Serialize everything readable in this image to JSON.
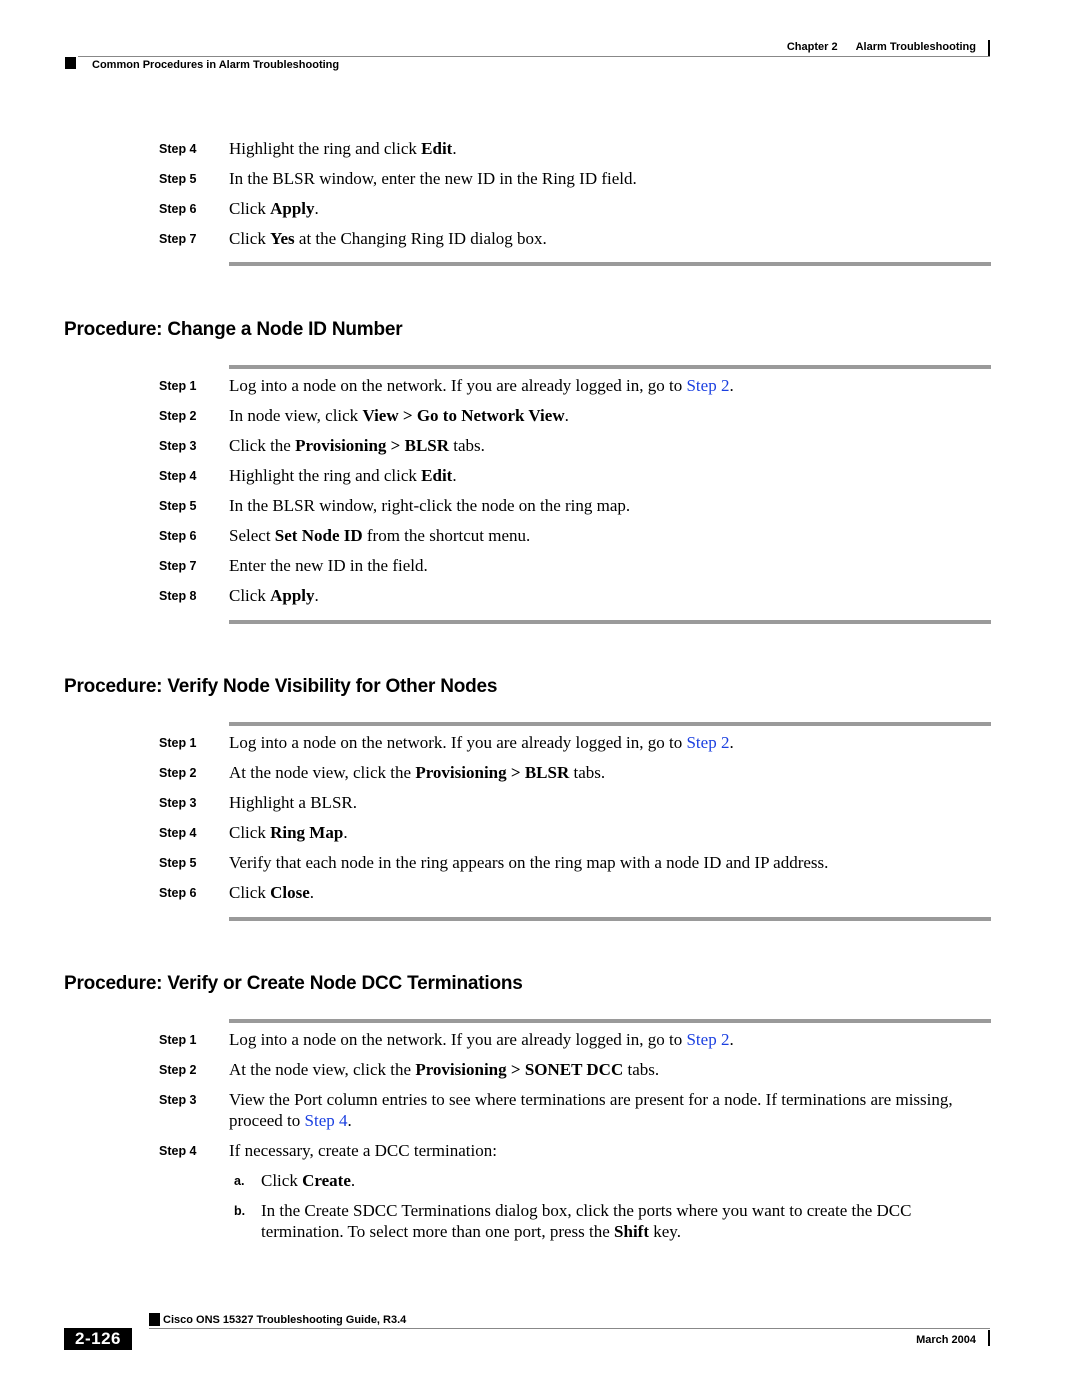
{
  "header": {
    "chapter": "Chapter 2",
    "chapter_title": "Alarm Troubleshooting",
    "section": "Common Procedures in Alarm Troubleshooting"
  },
  "continued_steps": [
    {
      "label": "Step 4",
      "parts": [
        {
          "t": "Highlight the ring and click "
        },
        {
          "b": "Edit"
        },
        {
          "t": "."
        }
      ]
    },
    {
      "label": "Step 5",
      "parts": [
        {
          "t": "In the BLSR window, enter the new ID in the Ring ID field."
        }
      ]
    },
    {
      "label": "Step 6",
      "parts": [
        {
          "t": "Click "
        },
        {
          "b": "Apply"
        },
        {
          "t": "."
        }
      ]
    },
    {
      "label": "Step 7",
      "parts": [
        {
          "t": "Click "
        },
        {
          "b": "Yes"
        },
        {
          "t": " at the Changing Ring ID dialog box."
        }
      ]
    }
  ],
  "procedures": [
    {
      "title": "Procedure: Change a Node ID Number",
      "steps": [
        {
          "label": "Step 1",
          "parts": [
            {
              "t": "Log into a node on the network. If you are already logged in, go to "
            },
            {
              "a": "Step 2"
            },
            {
              "t": "."
            }
          ]
        },
        {
          "label": "Step 2",
          "parts": [
            {
              "t": "In node view, click "
            },
            {
              "b": "View > Go to Network View"
            },
            {
              "t": "."
            }
          ]
        },
        {
          "label": "Step 3",
          "parts": [
            {
              "t": "Click the "
            },
            {
              "b": "Provisioning > BLSR"
            },
            {
              "t": " tabs."
            }
          ]
        },
        {
          "label": "Step 4",
          "parts": [
            {
              "t": "Highlight the ring and click "
            },
            {
              "b": "Edit"
            },
            {
              "t": "."
            }
          ]
        },
        {
          "label": "Step 5",
          "parts": [
            {
              "t": "In the BLSR window, right-click the node on the ring map."
            }
          ]
        },
        {
          "label": "Step 6",
          "parts": [
            {
              "t": "Select "
            },
            {
              "b": "Set Node ID"
            },
            {
              "t": " from the shortcut menu."
            }
          ]
        },
        {
          "label": "Step 7",
          "parts": [
            {
              "t": "Enter the new ID in the field."
            }
          ]
        },
        {
          "label": "Step 8",
          "parts": [
            {
              "t": "Click "
            },
            {
              "b": "Apply"
            },
            {
              "t": "."
            }
          ]
        }
      ]
    },
    {
      "title": "Procedure: Verify Node Visibility for Other Nodes",
      "steps": [
        {
          "label": "Step 1",
          "parts": [
            {
              "t": "Log into a node on the network. If you are already logged in, go to "
            },
            {
              "a": "Step 2"
            },
            {
              "t": "."
            }
          ]
        },
        {
          "label": "Step 2",
          "parts": [
            {
              "t": "At the node view, click the "
            },
            {
              "b": "Provisioning > BLSR"
            },
            {
              "t": " tabs."
            }
          ]
        },
        {
          "label": "Step 3",
          "parts": [
            {
              "t": "Highlight a BLSR."
            }
          ]
        },
        {
          "label": "Step 4",
          "parts": [
            {
              "t": "Click "
            },
            {
              "b": "Ring Map"
            },
            {
              "t": "."
            }
          ]
        },
        {
          "label": "Step 5",
          "parts": [
            {
              "t": "Verify that each node in the ring appears on the ring map with a node ID and IP address."
            }
          ]
        },
        {
          "label": "Step 6",
          "parts": [
            {
              "t": "Click "
            },
            {
              "b": "Close"
            },
            {
              "t": "."
            }
          ]
        }
      ]
    },
    {
      "title": "Procedure: Verify or Create Node DCC Terminations",
      "steps": [
        {
          "label": "Step 1",
          "parts": [
            {
              "t": "Log into a node on the network. If you are already logged in, go to "
            },
            {
              "a": "Step 2"
            },
            {
              "t": "."
            }
          ]
        },
        {
          "label": "Step 2",
          "parts": [
            {
              "t": "At the node view, click the "
            },
            {
              "b": "Provisioning > SONET DCC"
            },
            {
              "t": " tabs."
            }
          ]
        },
        {
          "label": "Step 3",
          "parts": [
            {
              "t": "View the Port column entries to see where terminations are present for a node. If terminations are missing, proceed to "
            },
            {
              "a": "Step 4"
            },
            {
              "t": "."
            }
          ]
        },
        {
          "label": "Step 4",
          "parts": [
            {
              "t": "If necessary, create a DCC termination:"
            }
          ],
          "substeps": [
            {
              "label": "a.",
              "parts": [
                {
                  "t": "Click "
                },
                {
                  "b": "Create"
                },
                {
                  "t": "."
                }
              ]
            },
            {
              "label": "b.",
              "parts": [
                {
                  "t": "In the Create SDCC Terminations dialog box, click the ports where you want to create the DCC termination. To select more than one port, press the "
                },
                {
                  "b": "Shift"
                },
                {
                  "t": " key."
                }
              ]
            }
          ]
        }
      ]
    }
  ],
  "footer": {
    "guide_title": "Cisco ONS 15327 Troubleshooting Guide, R3.4",
    "page_number": "2-126",
    "date": "March 2004"
  },
  "colors": {
    "link": "#1a3fe0",
    "rule": "#9a9a9a"
  }
}
